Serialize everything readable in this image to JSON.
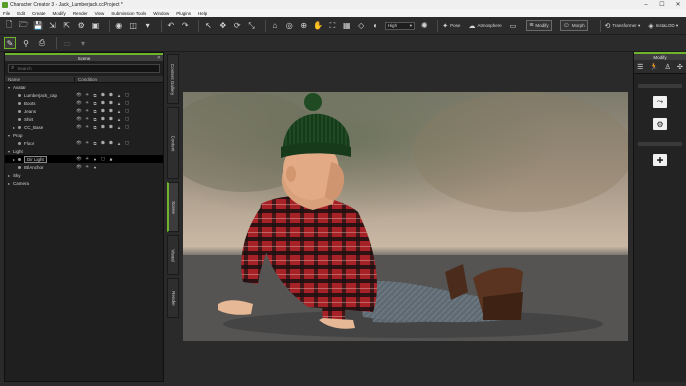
{
  "window": {
    "title": "Character Creator 3 - Jack_Lumberjack.ccProject *",
    "buttons": [
      "minimize-icon",
      "maximize-icon",
      "close-icon"
    ]
  },
  "menu": [
    "File",
    "Edit",
    "Create",
    "Modify",
    "Render",
    "View",
    "Submission Tools",
    "Window",
    "Plugins",
    "Help"
  ],
  "toolbar": {
    "quality_select": "High",
    "pose_label": "Pose",
    "atmosphere_label": "Atmosphere",
    "modify_label": "Modify",
    "morph_label": "Morph",
    "transformer_label": "Transformer",
    "instalod_label": "InstaLOD"
  },
  "scene": {
    "title": "Scene",
    "search_placeholder": "Search",
    "columns": {
      "name": "Name",
      "condition": "Condition"
    },
    "tree": [
      {
        "label": "Avatar",
        "indent": 0,
        "expander": "▾",
        "conds": []
      },
      {
        "label": "Lumberjack_cap",
        "indent": 1,
        "expander": "",
        "conds": [
          "👁",
          "☀",
          "⧉",
          "⬢",
          "⬢",
          "▲",
          "▢"
        ]
      },
      {
        "label": "Boots",
        "indent": 1,
        "expander": "",
        "conds": [
          "👁",
          "☀",
          "⧉",
          "⬢",
          "⬢",
          "▲",
          "▢"
        ]
      },
      {
        "label": "Jeans",
        "indent": 1,
        "expander": "",
        "conds": [
          "👁",
          "☀",
          "⧉",
          "⬢",
          "⬢",
          "▲",
          "▢"
        ]
      },
      {
        "label": "Shirt",
        "indent": 1,
        "expander": "",
        "conds": [
          "👁",
          "☀",
          "⧉",
          "⬢",
          "⬢",
          "▲",
          "▢"
        ]
      },
      {
        "label": "CC_Base",
        "indent": 1,
        "expander": "▸",
        "conds": [
          "👁",
          "☀",
          "⧉",
          "⬢",
          "⬢",
          "▲",
          "▢"
        ]
      },
      {
        "label": "Prop",
        "indent": 0,
        "expander": "▾",
        "conds": []
      },
      {
        "label": "Floor",
        "indent": 1,
        "expander": "",
        "conds": [
          "👁",
          "☀",
          "⧉",
          "⬢",
          "⬢",
          "▲",
          "▢"
        ]
      },
      {
        "label": "Light",
        "indent": 0,
        "expander": "▾",
        "conds": []
      },
      {
        "label": "Dir Light",
        "indent": 1,
        "expander": "▸",
        "conds": [
          "👁",
          "☀",
          "●",
          "▢",
          "■"
        ],
        "selected": true
      },
      {
        "label": "IBlAnchor",
        "indent": 1,
        "expander": "",
        "conds": [
          "👁",
          "☀",
          "●"
        ]
      },
      {
        "label": "Sky",
        "indent": 0,
        "expander": "▸",
        "conds": []
      },
      {
        "label": "Camera",
        "indent": 0,
        "expander": "▸",
        "conds": []
      }
    ]
  },
  "side_tabs": [
    "Content Gallery",
    "Content",
    "Scene",
    "Visual",
    "Render"
  ],
  "modify": {
    "title": "Modify",
    "tab_icons": [
      "sliders-icon",
      "person-run-icon",
      "person-icon",
      "puzzle-icon"
    ]
  },
  "colors": {
    "accent_green": "#6fb52c",
    "shirt_red": "#a62226",
    "beanie_green": "#1f4a22"
  }
}
